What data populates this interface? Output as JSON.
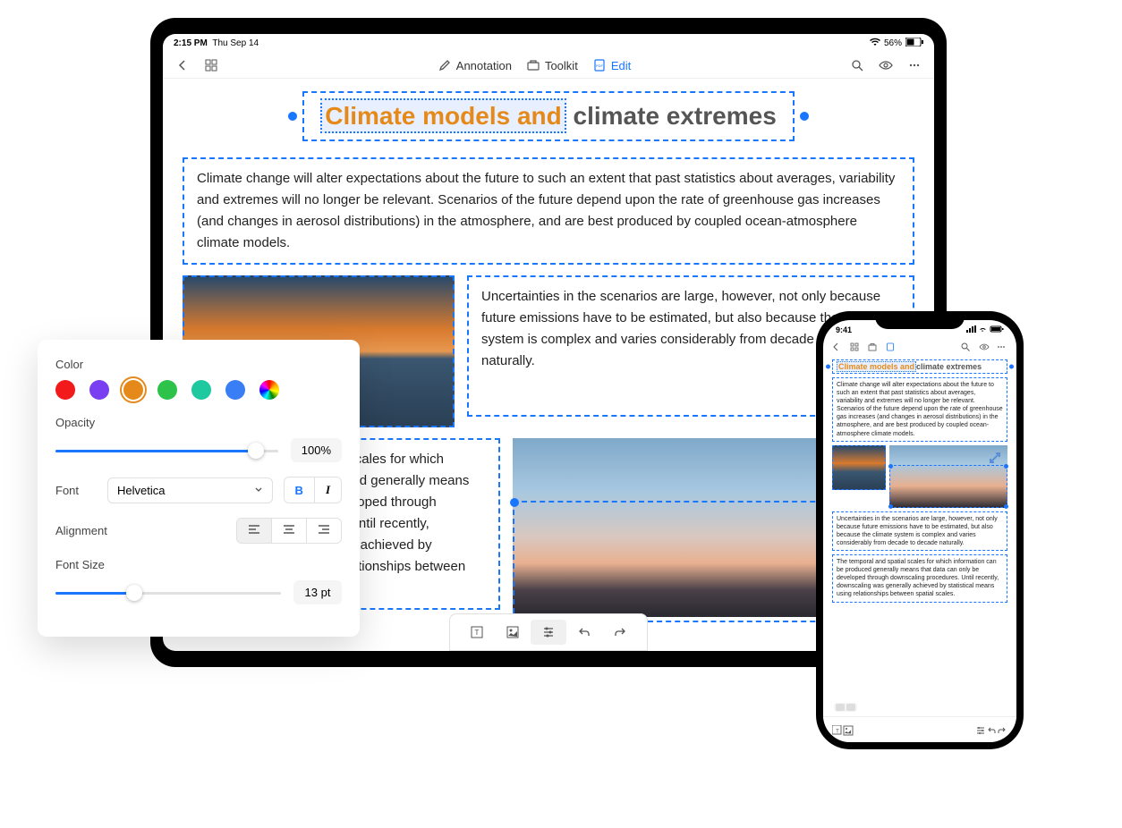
{
  "tablet": {
    "status": {
      "time": "2:15 PM",
      "date": "Thu Sep 14",
      "battery": "56%"
    },
    "toolbar": {
      "annotation": "Annotation",
      "toolkit": "Toolkit",
      "edit": "Edit"
    },
    "title_selected": "Climate models and",
    "title_rest": " climate extremes",
    "para1": "Climate change will alter expectations about the future to such an extent that past statistics about averages, variability and extremes will no longer be relevant. Scenarios of the future depend upon the rate of greenhouse gas increases (and changes in aerosol distributions) in the atmosphere, and are best produced by coupled ocean-atmosphere climate models.",
    "para2": "Uncertainties in the scenarios are large, however, not only because future emissions have to be estimated, but also because the climate system is complex and varies considerably from decade to decade naturally.",
    "para3": "The temporal and spatial scales for which information can be produced generally means that data can only be developed through downscaling procedures. Until recently, downscaling was generally achieved by statistical means using relationships between spatial scales."
  },
  "inspector": {
    "color_label": "Color",
    "opacity_label": "Opacity",
    "opacity_value": "100%",
    "font_label": "Font",
    "font_value": "Helvetica",
    "alignment_label": "Alignment",
    "fontsize_label": "Font Size",
    "fontsize_value": "13 pt",
    "colors": [
      "#f21a1a",
      "#7a3ff0",
      "#e58a1a",
      "#2dc24a",
      "#1fc9a0",
      "#3a7ef5"
    ]
  },
  "phone": {
    "status_time": "9:41",
    "title_selected": "Climate models and",
    "title_rest": "climate extremes",
    "para1": "Climate change will alter expectations about the future to such an extent that past statistics about averages, variability and extremes will no longer be relevant. Scenarios of the future depend upon the rate of greenhouse gas increases (and changes in aerosol distributions) in the atmosphere, and are best produced by coupled ocean-atmosphere climate models.",
    "para2": "Uncertainties in the scenarios are large, however, not only because future emissions have to be estimated, but also because the climate system is complex and varies considerably from decade to decade naturally.",
    "para3": "The temporal and spatial scales for which information can be produced generally means that data can only be developed through downscaling procedures. Until recently, downscaling was generally achieved by statistical means using relationships between spatial scales."
  }
}
